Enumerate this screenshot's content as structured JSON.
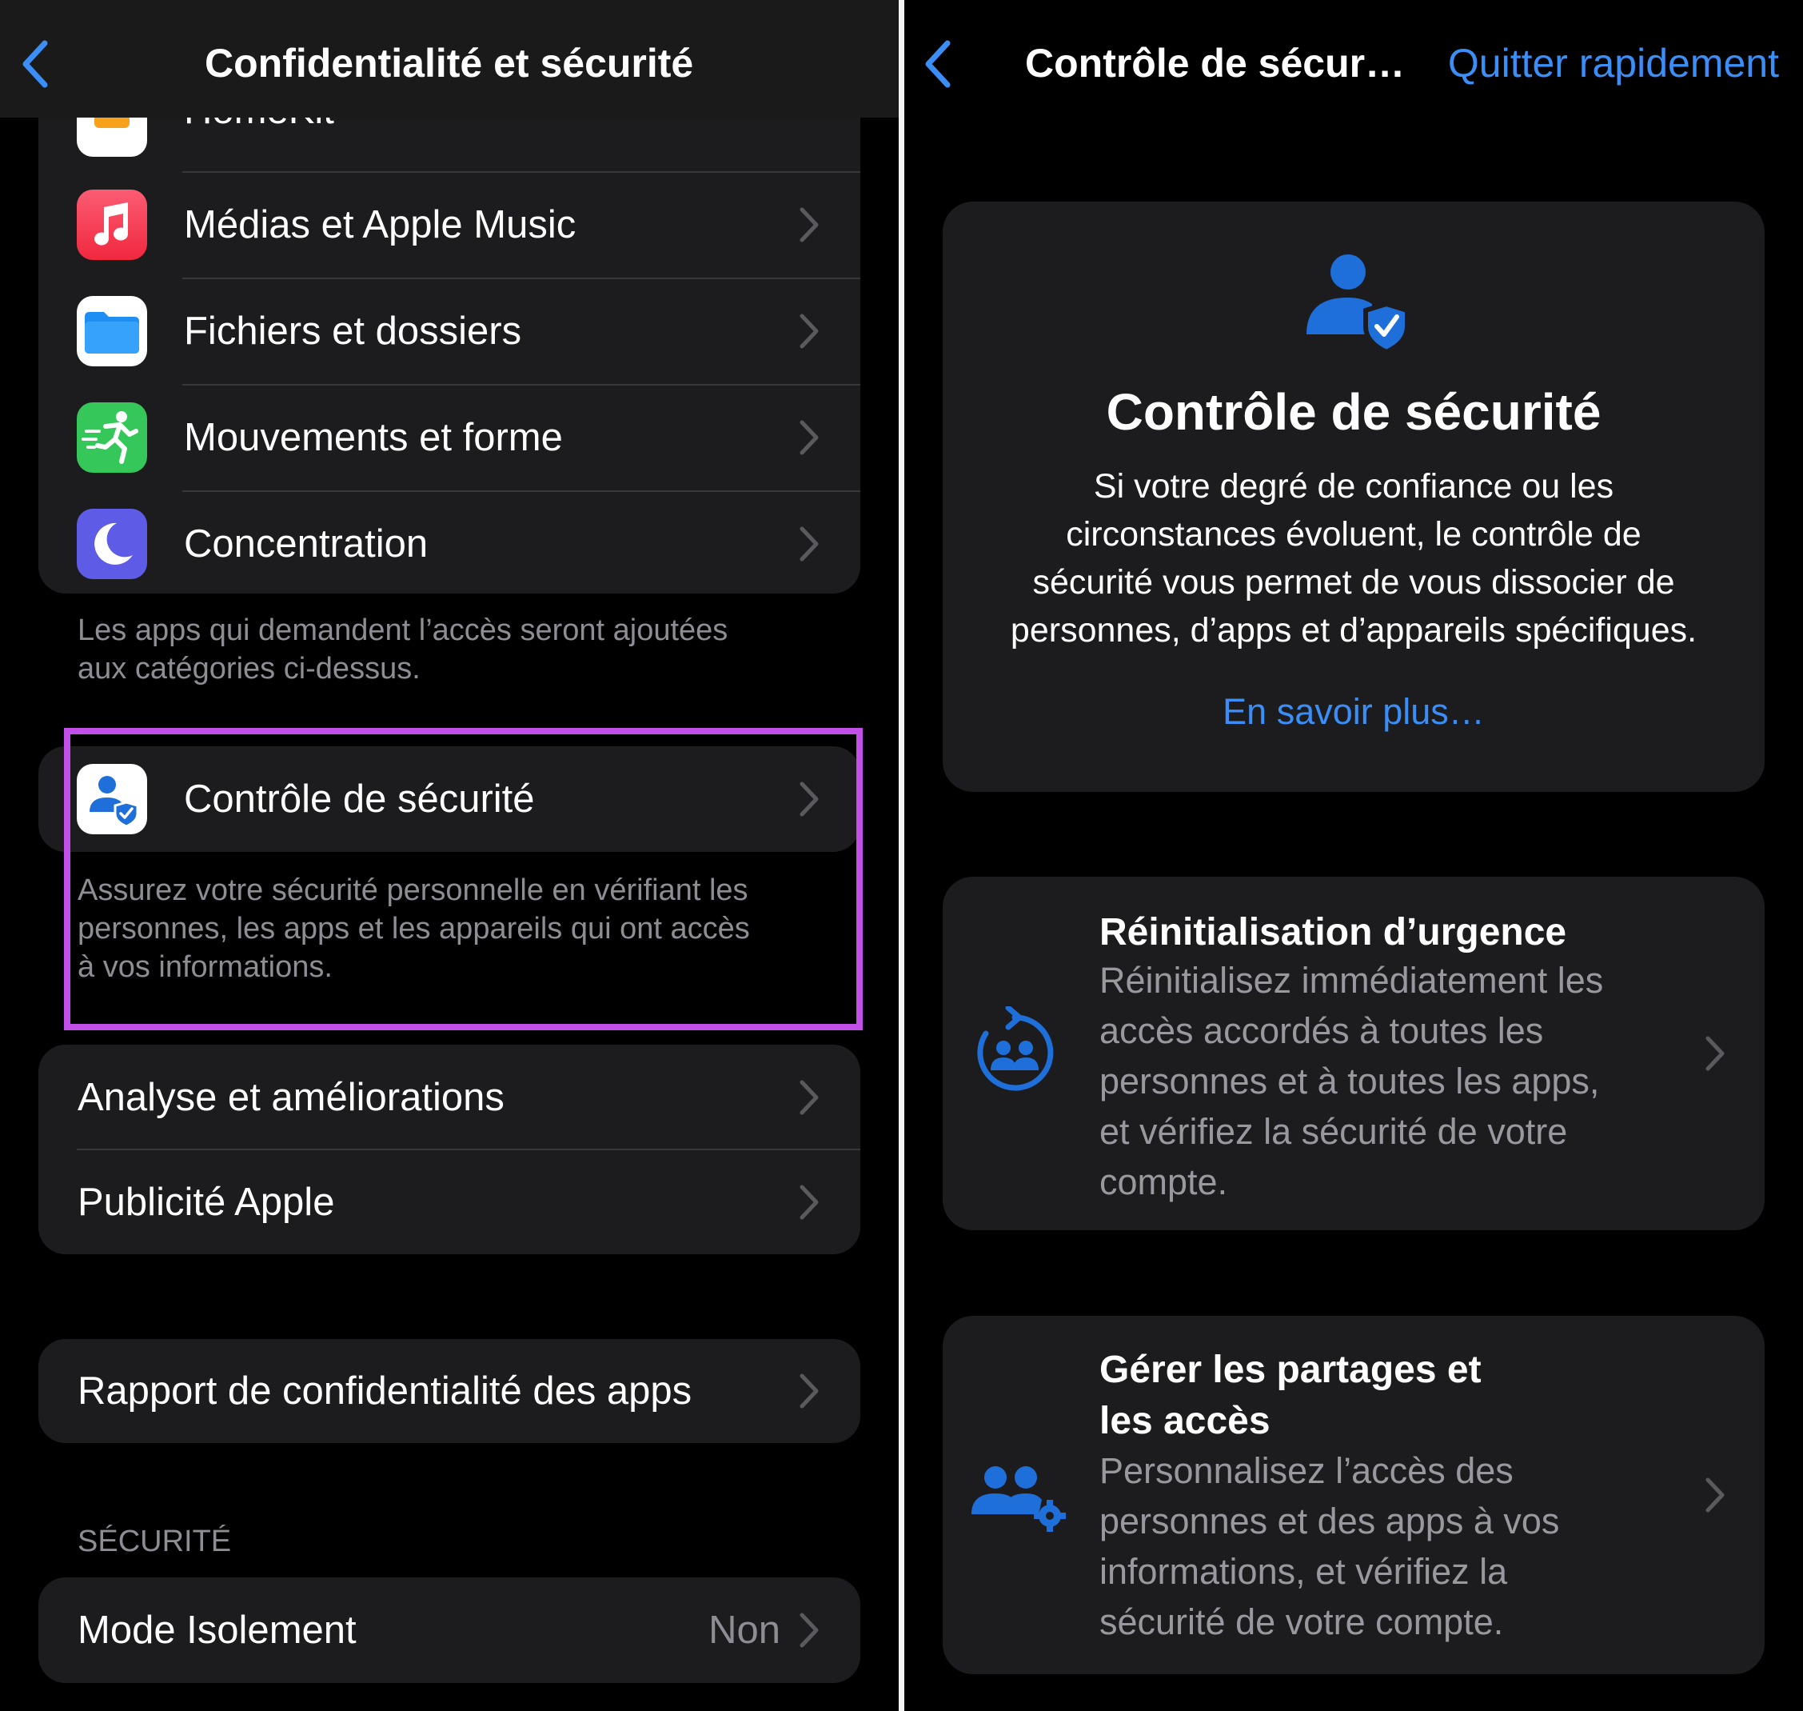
{
  "left": {
    "nav": {
      "title": "Confidentialité et sécurité"
    },
    "group1": {
      "items": [
        {
          "label": "HomeKit",
          "icon": "homekit-icon"
        },
        {
          "label": "Médias et Apple Music",
          "icon": "music-note-icon"
        },
        {
          "label": "Fichiers et dossiers",
          "icon": "folder-icon"
        },
        {
          "label": "Mouvements et forme",
          "icon": "running-figure-icon"
        },
        {
          "label": "Concentration",
          "icon": "moon-icon"
        }
      ],
      "footer": [
        "Les apps qui demandent l’accès seront ajoutées",
        "aux catégories ci-dessus."
      ]
    },
    "safety": {
      "label": "Contrôle de sécurité",
      "icon": "person-shield-icon",
      "footer": [
        "Assurez votre sécurité personnelle en vérifiant les",
        "personnes, les apps et les appareils qui ont accès",
        "à vos informations."
      ]
    },
    "group3": {
      "items": [
        "Analyse et améliorations",
        "Publicité Apple"
      ]
    },
    "group4": {
      "items": [
        "Rapport de confidentialité des apps"
      ]
    },
    "security_section": {
      "header": "SÉCURITÉ",
      "item": {
        "label": "Mode Isolement",
        "value": "Non"
      }
    }
  },
  "right": {
    "nav": {
      "title": "Contrôle de sécur…",
      "quick_exit": "Quitter rapidement"
    },
    "hero": {
      "title": "Contrôle de sécurité",
      "desc": [
        "Si votre degré de confiance ou les",
        "circonstances évoluent, le contrôle de",
        "sécurité vous permet de vous dissocier de",
        "personnes, d’apps et d’appareils spécifiques."
      ],
      "link": "En savoir plus…"
    },
    "emergency": {
      "title": "Réinitialisation d’urgence",
      "desc": [
        "Réinitialisez immédiatement les",
        "accès accordés à toutes les",
        "personnes et à toutes les apps,",
        "et vérifiez la sécurité de votre",
        "compte."
      ]
    },
    "manage": {
      "title": [
        "Gérer les partages et",
        "les accès"
      ],
      "desc": [
        "Personnalisez l’accès des",
        "personnes et des apps à vos",
        "informations, et vérifiez la",
        "sécurité de votre compte."
      ]
    }
  },
  "colors": {
    "accent": "#3a8ef6",
    "highlight": "#c14fe8",
    "group_bg": "#1c1c1e",
    "secondary_text": "#8d8d93"
  }
}
